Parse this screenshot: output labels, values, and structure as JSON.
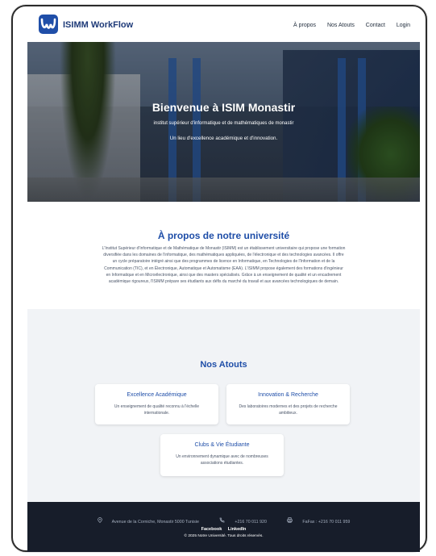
{
  "header": {
    "brand": "ISIMM WorkFlow",
    "nav": [
      "À propos",
      "Nos Atouts",
      "Contact",
      "Login"
    ]
  },
  "hero": {
    "title": "Bienvenue à ISIM Monastir",
    "subtitle": "institut supérieur d'informatique et de mathématiques de monastir",
    "tagline": "Un lieu d'excellence académique et d'innovation."
  },
  "about": {
    "title": "À propos de notre université",
    "text": "L'Institut Supérieur d'Informatique et de Mathématique de Monastir (ISIMM) est un établissement universitaire qui propose une formation diversifiée dans les domaines de l'informatique, des mathématiques appliquées, de l'électronique et des technologies avancées. Il offre un cycle préparatoire intégré ainsi que des programmes de licence en Informatique, en Technologies de l'Information et de la Communication (TIC), et en Électronique, Automatique et Automatisme (EAA). L'ISIMM propose également des formations d'ingénieur en Informatique et en Microélectronique, ainsi que des masters spécialisés. Grâce à un enseignement de qualité et un encadrement académique rigoureux, l'ISIMM prépare ses étudiants aux défis du marché du travail et aux avancées technologiques de demain."
  },
  "atouts": {
    "title": "Nos Atouts",
    "cards": [
      {
        "title": "Excellence Académique",
        "desc": "Un enseignement de qualité reconnu à l'échelle internationale."
      },
      {
        "title": "Innovation & Recherche",
        "desc": "Des laboratoires modernes et des projets de recherche ambitieux."
      },
      {
        "title": "Clubs & Vie Étudiante",
        "desc": "Un environnement dynamique avec de nombreuses associations étudiantes."
      }
    ]
  },
  "footer": {
    "address": "Avenue de la Corniche, Monastir 5000 Tunisie",
    "phone": "+216 70 011 920",
    "fax": "FaFax : +216 70 011 959",
    "links": [
      "Facebook",
      "LinkedIn"
    ],
    "copyright": "© 2025 Notre Université. Tous droits réservés."
  },
  "colors": {
    "brand": "#1f4ea8",
    "footer": "#171d2a",
    "atouts_bg": "#f1f3f6"
  },
  "icons": [
    "logo-icon",
    "location-icon",
    "phone-icon",
    "printer-icon"
  ]
}
